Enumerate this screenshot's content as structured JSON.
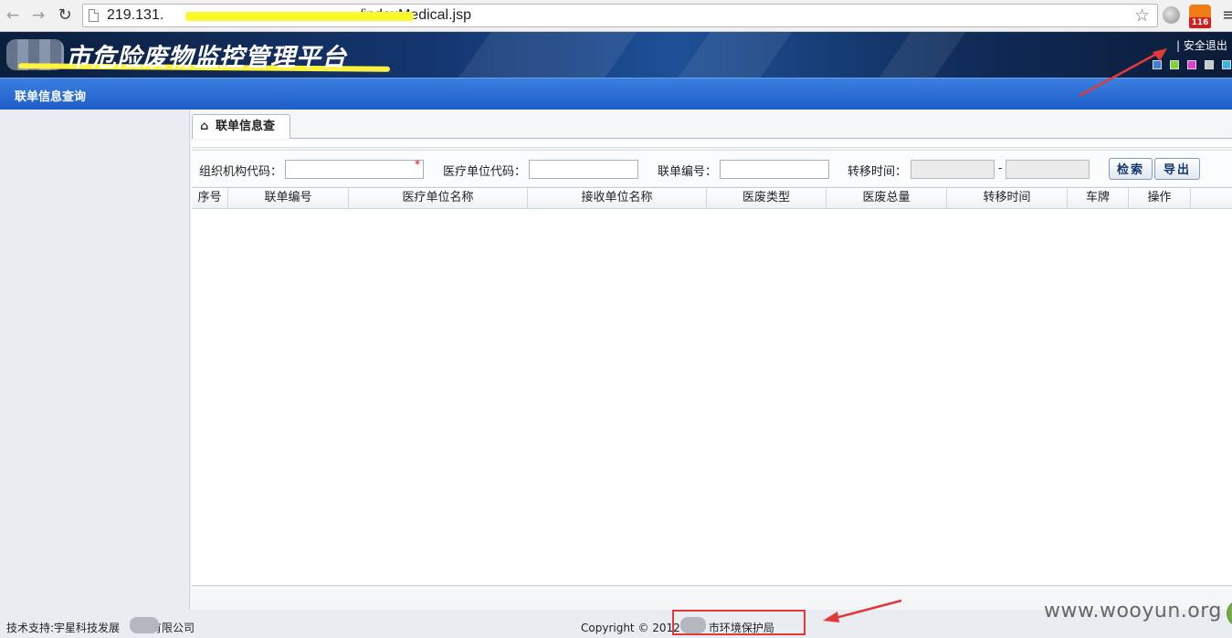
{
  "browser": {
    "url_visible_start": "219.131.",
    "url_visible_end": "/indexMedical.jsp",
    "rss_badge": "116"
  },
  "header": {
    "title": "市危险废物监控管理平台",
    "logout": "| 安全退出",
    "theme_colors": [
      "#3a7fe0",
      "#7fd13a",
      "#e83ad6",
      "#c9c9c9",
      "#33b7e8"
    ]
  },
  "nav": {
    "section_title": "联单信息查询"
  },
  "tab": {
    "label": "联单信息查"
  },
  "search": {
    "org_code_label": "组织机构代码：",
    "org_code_value": "",
    "required_mark": "*",
    "medical_code_label": "医疗单位代码：",
    "medical_code_value": "",
    "manifest_no_label": "联单编号：",
    "manifest_no_value": "",
    "transfer_time_label": "转移时间：",
    "transfer_from": "",
    "transfer_to": "",
    "range_sep": "-",
    "search_button": "检索",
    "export_button": "导出"
  },
  "table": {
    "columns": [
      "序号",
      "联单编号",
      "医疗单位名称",
      "接收单位名称",
      "医废类型",
      "医废总量",
      "转移时间",
      "车牌",
      "操作"
    ],
    "rows": []
  },
  "footer": {
    "support_prefix": "技术支持:宇星科技发展",
    "support_suffix": "有限公司",
    "copyright_prefix": "Copyright © 2012",
    "copyright_suffix": "市环境保护局"
  },
  "watermark": "www.wooyun.org"
}
